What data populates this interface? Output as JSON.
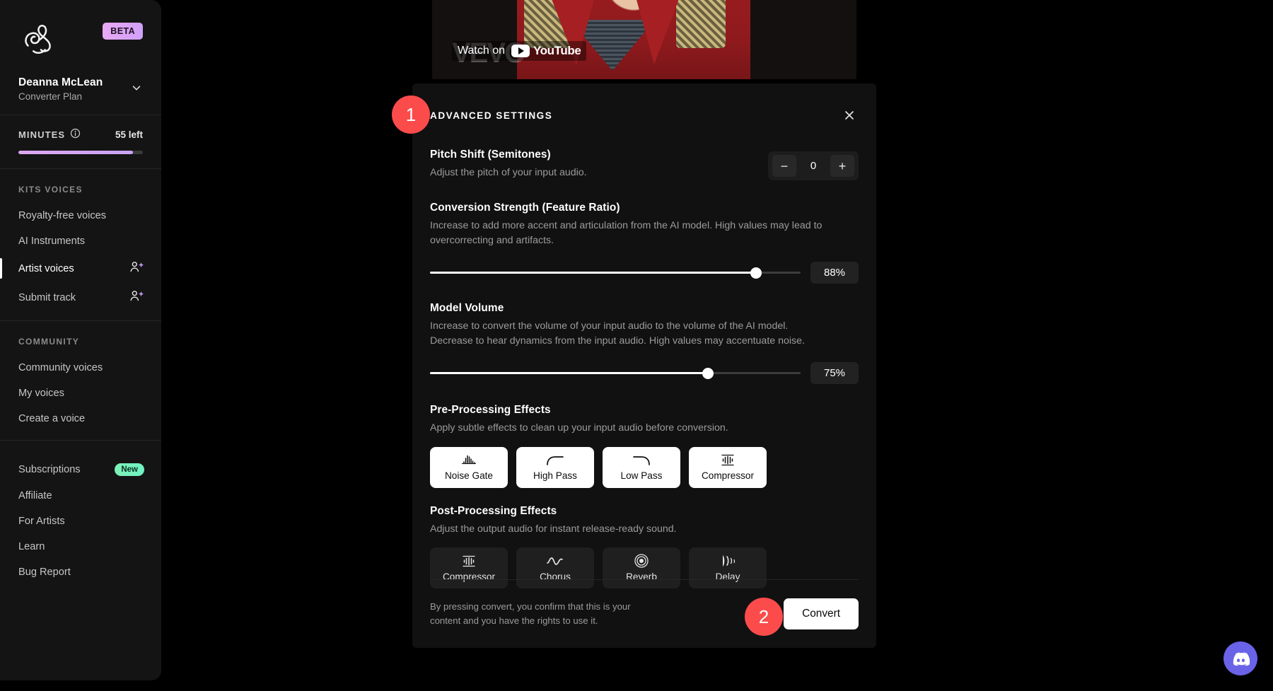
{
  "sidebar": {
    "badge": "BETA",
    "account": {
      "name": "Deanna McLean",
      "plan": "Converter Plan"
    },
    "minutes": {
      "label": "MINUTES",
      "remaining": "55 left",
      "percent": 92
    },
    "sections": [
      {
        "heading": "KITS VOICES",
        "items": [
          {
            "label": "Royalty-free voices",
            "icon": "",
            "active": false
          },
          {
            "label": "AI Instruments",
            "icon": "",
            "active": false
          },
          {
            "label": "Artist voices",
            "icon": "user-sparkle-icon",
            "active": true
          },
          {
            "label": "Submit track",
            "icon": "user-sparkle-icon",
            "active": false
          }
        ]
      },
      {
        "heading": "COMMUNITY",
        "items": [
          {
            "label": "Community voices",
            "icon": "",
            "active": false
          },
          {
            "label": "My voices",
            "icon": "",
            "active": false
          },
          {
            "label": "Create a voice",
            "icon": "",
            "active": false
          }
        ]
      },
      {
        "heading": "",
        "items": [
          {
            "label": "Subscriptions",
            "badge": "New",
            "active": false
          },
          {
            "label": "Affiliate",
            "active": false
          },
          {
            "label": "For Artists",
            "active": false
          },
          {
            "label": "Learn",
            "active": false
          },
          {
            "label": "Bug Report",
            "active": false
          }
        ]
      }
    ]
  },
  "video": {
    "watch_on": "Watch on",
    "youtube": "YouTube",
    "watermark": "VEVO"
  },
  "panel": {
    "title": "ADVANCED SETTINGS",
    "close_icon": "close-icon",
    "pitch": {
      "title": "Pitch Shift (Semitones)",
      "desc": "Adjust the pitch of your input audio.",
      "value": "0",
      "minus": "−",
      "plus": "+"
    },
    "conversion": {
      "title": "Conversion Strength (Feature Ratio)",
      "desc": "Increase to add more accent and articulation from the AI model. High values may lead to overcorrecting and artifacts.",
      "value": "88%",
      "percent": 88
    },
    "volume": {
      "title": "Model Volume",
      "desc": "Increase to convert the volume of your input audio to the volume of the AI model. Decrease to hear dynamics from the input audio. High values may accentuate noise.",
      "value": "75%",
      "percent": 75
    },
    "pre": {
      "title": "Pre-Processing Effects",
      "desc": "Apply subtle effects to clean up your input audio before conversion.",
      "buttons": [
        {
          "label": "Noise Gate",
          "icon": "noise-gate-icon",
          "selected": true
        },
        {
          "label": "High Pass",
          "icon": "high-pass-icon",
          "selected": true
        },
        {
          "label": "Low Pass",
          "icon": "low-pass-icon",
          "selected": true
        },
        {
          "label": "Compressor",
          "icon": "compressor-icon",
          "selected": true
        }
      ]
    },
    "post": {
      "title": "Post-Processing Effects",
      "desc": "Adjust the output audio for instant release-ready sound.",
      "buttons": [
        {
          "label": "Compressor",
          "icon": "compressor-icon",
          "selected": false
        },
        {
          "label": "Chorus",
          "icon": "chorus-icon",
          "selected": false
        },
        {
          "label": "Reverb",
          "icon": "reverb-icon",
          "selected": false
        },
        {
          "label": "Delay",
          "icon": "delay-icon",
          "selected": false
        }
      ]
    },
    "footer": {
      "disclaimer": "By pressing convert, you confirm that this is your content and you have the rights to use it.",
      "convert": "Convert"
    }
  },
  "markers": [
    {
      "number": "1"
    },
    {
      "number": "2"
    }
  ],
  "discord": {
    "icon": "discord-icon"
  },
  "colors": {
    "accent_marker": "#fb4b4b",
    "beta_badge": "#e4a6f3",
    "new_badge": "#7ff0b6",
    "discord": "#6a63e8",
    "panel_bg": "#111111",
    "sidebar_bg": "#141414"
  }
}
